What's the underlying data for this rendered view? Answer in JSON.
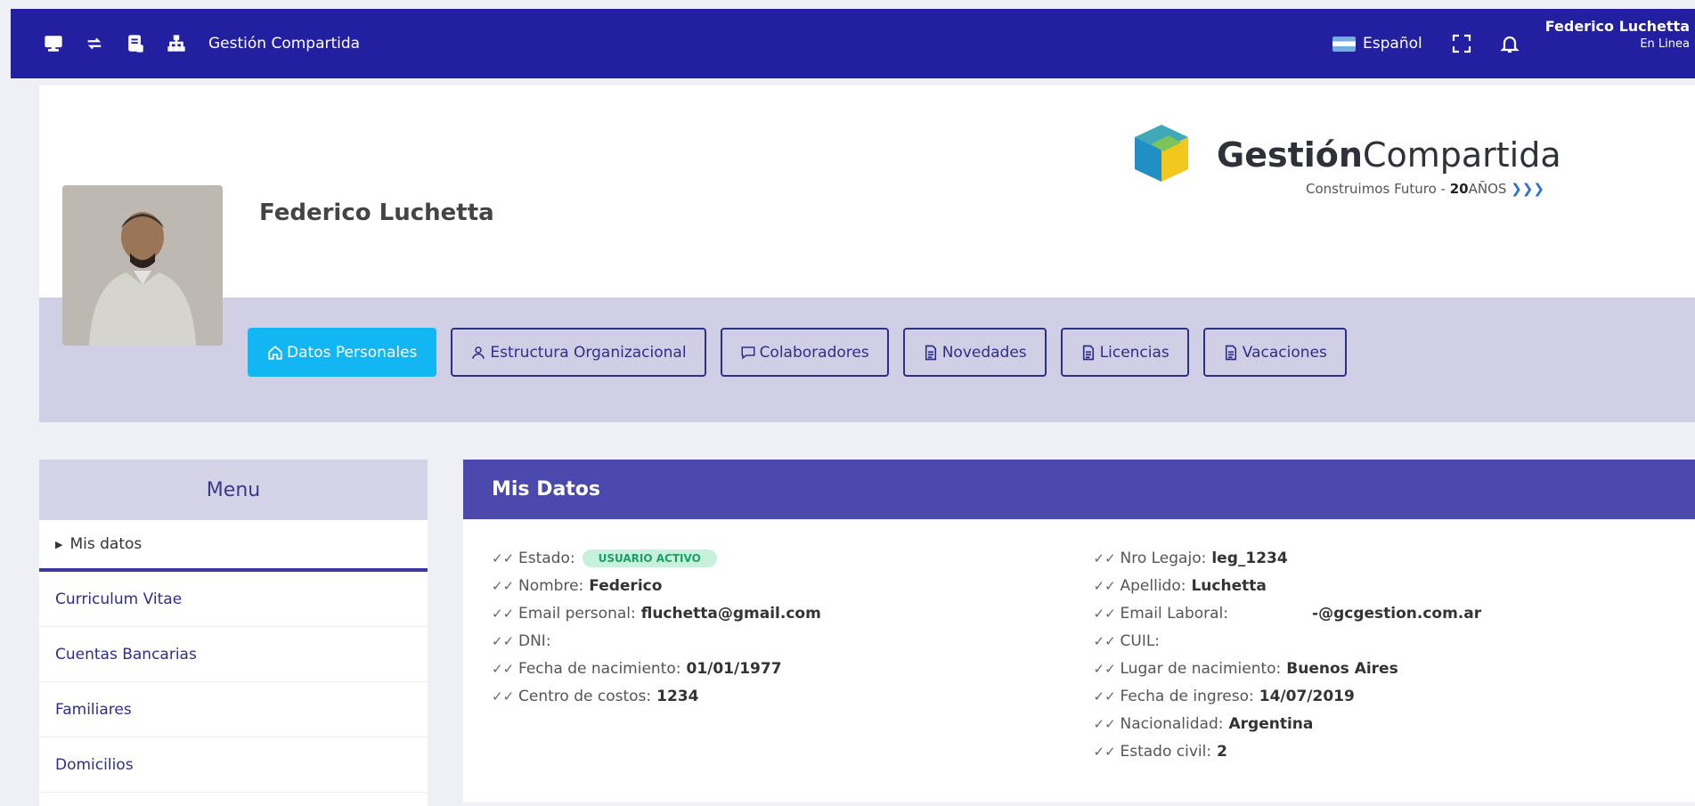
{
  "topbar": {
    "title": "Gestión Compartida",
    "language": "Español",
    "user_name": "Federico Luchetta",
    "user_status": "En Linea",
    "icons": [
      "monitor-icon",
      "swap-icon",
      "report-icon",
      "org-chart-icon",
      "flag-argentina-icon",
      "fullscreen-icon",
      "bell-icon"
    ]
  },
  "profile": {
    "name": "Federico Luchetta",
    "logo": {
      "brand_bold": "Gestión",
      "brand_light": "Compartida",
      "tagline": "Construimos Futuro - ",
      "tagline_bold": "20",
      "tagline_suffix": "AÑOS",
      "chevrons": "❯❯❯"
    }
  },
  "tabs": [
    {
      "label": "Datos Personales",
      "icon": "home-icon",
      "active": true
    },
    {
      "label": "Estructura Organizacional",
      "icon": "user-icon",
      "active": false
    },
    {
      "label": "Colaboradores",
      "icon": "comment-icon",
      "active": false
    },
    {
      "label": "Novedades",
      "icon": "document-icon",
      "active": false
    },
    {
      "label": "Licencias",
      "icon": "document-icon",
      "active": false
    },
    {
      "label": "Vacaciones",
      "icon": "document-icon",
      "active": false
    }
  ],
  "menu": {
    "title": "Menu",
    "items": [
      "Mis datos",
      "Curriculum Vitae",
      "Cuentas Bancarias",
      "Familiares",
      "Domicilios"
    ]
  },
  "mis_datos": {
    "title": "Mis Datos",
    "estado_label": "Estado:",
    "estado_badge": "USUARIO ACTIVO",
    "left": [
      {
        "label": "Nombre:",
        "value": "Federico"
      },
      {
        "label": "Email personal:",
        "value": "fluchetta@gmail.com"
      },
      {
        "label": "DNI:",
        "value": ""
      },
      {
        "label": "Fecha de nacimiento:",
        "value": "01/01/1977"
      },
      {
        "label": "Centro de costos:",
        "value": "1234"
      }
    ],
    "right": [
      {
        "label": "Nro Legajo:",
        "value": "leg_1234"
      },
      {
        "label": "Apellido:",
        "value": "Luchetta"
      },
      {
        "label": "Email Laboral:",
        "value": "-@gcgestion.com.ar"
      },
      {
        "label": "CUIL:",
        "value": ""
      },
      {
        "label": "Lugar de nacimiento:",
        "value": "Buenos Aires"
      },
      {
        "label": "Fecha de ingreso:",
        "value": "14/07/2019"
      },
      {
        "label": "Nacionalidad:",
        "value": "Argentina"
      },
      {
        "label": "Estado civil:",
        "value": "2"
      }
    ]
  },
  "colors": {
    "topbar": "#2220a0",
    "tab_active": "#12b6f2",
    "tab_border": "#2f2f86",
    "card_header": "#4b49ae",
    "band": "#d0cfe6",
    "badge_bg": "#c8f1dd",
    "badge_text": "#1aa062"
  }
}
